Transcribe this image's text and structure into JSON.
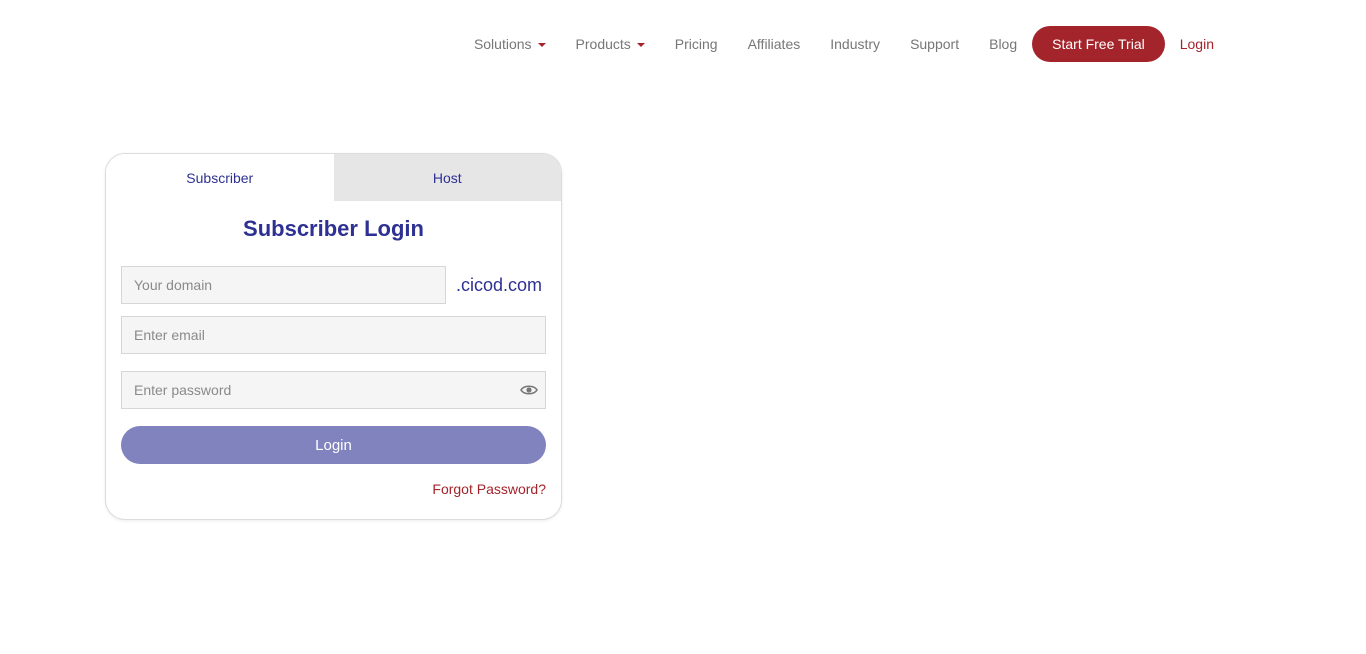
{
  "nav": {
    "items": [
      {
        "label": "Solutions",
        "dropdown": true
      },
      {
        "label": "Products",
        "dropdown": true
      },
      {
        "label": "Pricing",
        "dropdown": false
      },
      {
        "label": "Affiliates",
        "dropdown": false
      },
      {
        "label": "Industry",
        "dropdown": false
      },
      {
        "label": "Support",
        "dropdown": false
      },
      {
        "label": "Blog",
        "dropdown": false
      }
    ],
    "trial_label": "Start Free Trial",
    "login_label": "Login"
  },
  "login": {
    "tabs": [
      {
        "label": "Subscriber",
        "active": true
      },
      {
        "label": "Host",
        "active": false
      }
    ],
    "title": "Subscriber Login",
    "domain_placeholder": "Your domain",
    "domain_suffix": ".cicod.com",
    "email_placeholder": "Enter email",
    "password_placeholder": "Enter password",
    "password_icon": "eye-icon",
    "button_label": "Login",
    "forgot_label": "Forgot Password?"
  },
  "colors": {
    "brand_red": "#a3242b",
    "brand_blue": "#2e3192",
    "button_purple": "#8083bd",
    "tab_inactive_bg": "#e6e6e6"
  }
}
